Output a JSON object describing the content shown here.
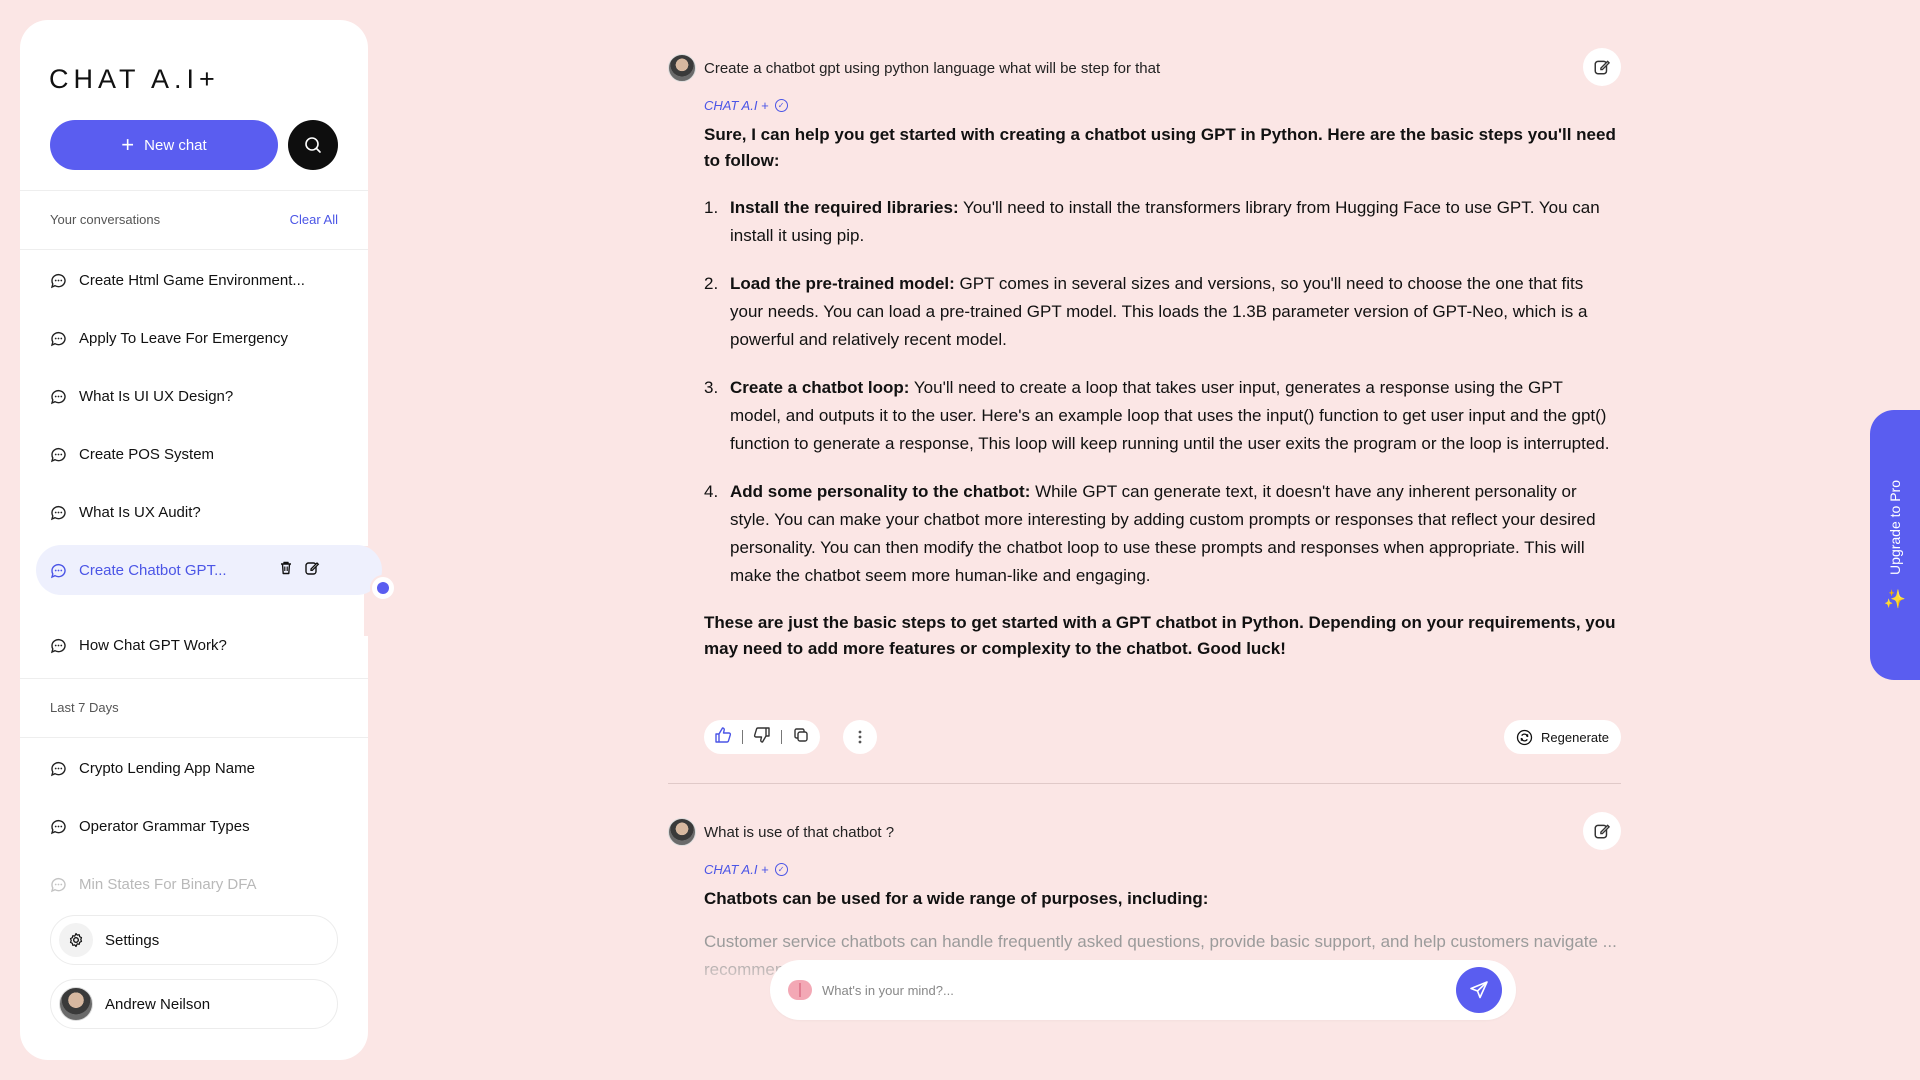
{
  "colors": {
    "accent": "#5a5df0",
    "background": "#fbe6e5",
    "panel": "#ffffff",
    "link": "#4b55e6"
  },
  "brand": "CHAT A.I+",
  "sidebar": {
    "new_chat_label": "New chat",
    "conversations_heading": "Your conversations",
    "clear_all": "Clear All",
    "conversations": [
      "Create Html Game Environment...",
      "Apply To Leave For Emergency",
      "What Is UI UX Design?",
      "Create POS System",
      "What Is UX Audit?",
      "Create Chatbot GPT...",
      "How Chat GPT Work?"
    ],
    "active_index": 5,
    "last7_heading": "Last 7 Days",
    "last7": [
      "Crypto Lending App Name",
      "Operator Grammar Types",
      "Min States For Binary DFA"
    ],
    "settings_label": "Settings",
    "user_name": "Andrew Neilson"
  },
  "thread": [
    {
      "question": "Create a chatbot gpt using python language what will be step for that",
      "ai_label": "CHAT A.I +",
      "intro": "Sure, I can help you get started with creating a chatbot using GPT in Python. Here are the basic steps you'll need to follow:",
      "steps": [
        {
          "num": "1.",
          "title": "Install the required libraries:",
          "text": " You'll need to install the transformers library from Hugging Face to use GPT. You can install it using pip."
        },
        {
          "num": "2.",
          "title": "Load the pre-trained model:",
          "text": " GPT comes in several sizes and versions, so you'll need to choose the one that fits your needs. You can load a pre-trained GPT model. This loads the 1.3B parameter version of GPT-Neo, which is a powerful and relatively recent model."
        },
        {
          "num": "3.",
          "title": "Create a chatbot loop:",
          "text": " You'll need to create a loop that takes user input, generates a response using the GPT model, and outputs it to the user. Here's an example loop that uses the input() function to get user input and the gpt() function to generate a response, This loop will keep running until the user exits the program or the loop is interrupted."
        },
        {
          "num": "4.",
          "title": "Add some personality to the chatbot:",
          "text": " While GPT can generate text, it doesn't have any inherent personality or style. You can make your chatbot more interesting by adding custom prompts or responses that reflect your desired personality. You can then modify the chatbot loop to use these prompts and responses when appropriate. This will make the chatbot seem more human-like and engaging."
        }
      ],
      "outro": "These are just the basic steps to get started with a GPT chatbot in Python. Depending on your requirements, you may need to add more features or complexity to the chatbot. Good luck!",
      "regenerate_label": "Regenerate"
    },
    {
      "question": "What is use of that chatbot ?",
      "ai_label": "CHAT A.I +",
      "intro": "Chatbots can be used for a wide range of purposes, including:",
      "partial": "Customer service chatbots can handle frequently asked questions, provide basic support, and help customers navigate ... recommend"
    }
  ],
  "prompt": {
    "placeholder": "What's in your mind?..."
  },
  "upgrade_label": "Upgrade to Pro"
}
